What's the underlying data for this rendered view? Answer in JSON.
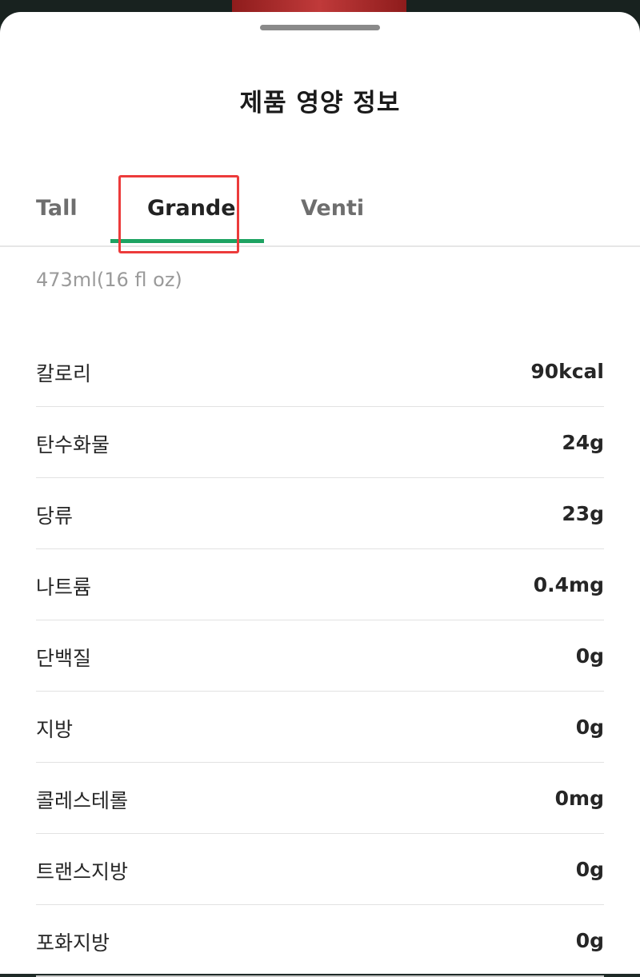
{
  "sheet": {
    "title": "제품 영양 정보"
  },
  "tabs": [
    {
      "label": "Tall"
    },
    {
      "label": "Grande",
      "selected": true
    },
    {
      "label": "Venti"
    }
  ],
  "volume": "473ml(16 fl oz)",
  "nutrients": [
    {
      "name": "칼로리",
      "value": "90kcal"
    },
    {
      "name": "탄수화물",
      "value": "24g"
    },
    {
      "name": "당류",
      "value": "23g"
    },
    {
      "name": "나트륨",
      "value": "0.4mg"
    },
    {
      "name": "단백질",
      "value": "0g"
    },
    {
      "name": "지방",
      "value": "0g"
    },
    {
      "name": "콜레스테롤",
      "value": "0mg"
    },
    {
      "name": "트랜스지방",
      "value": "0g"
    },
    {
      "name": "포화지방",
      "value": "0g"
    }
  ],
  "colors": {
    "accent": "#1ea362",
    "highlight": "#ec3b3b"
  }
}
